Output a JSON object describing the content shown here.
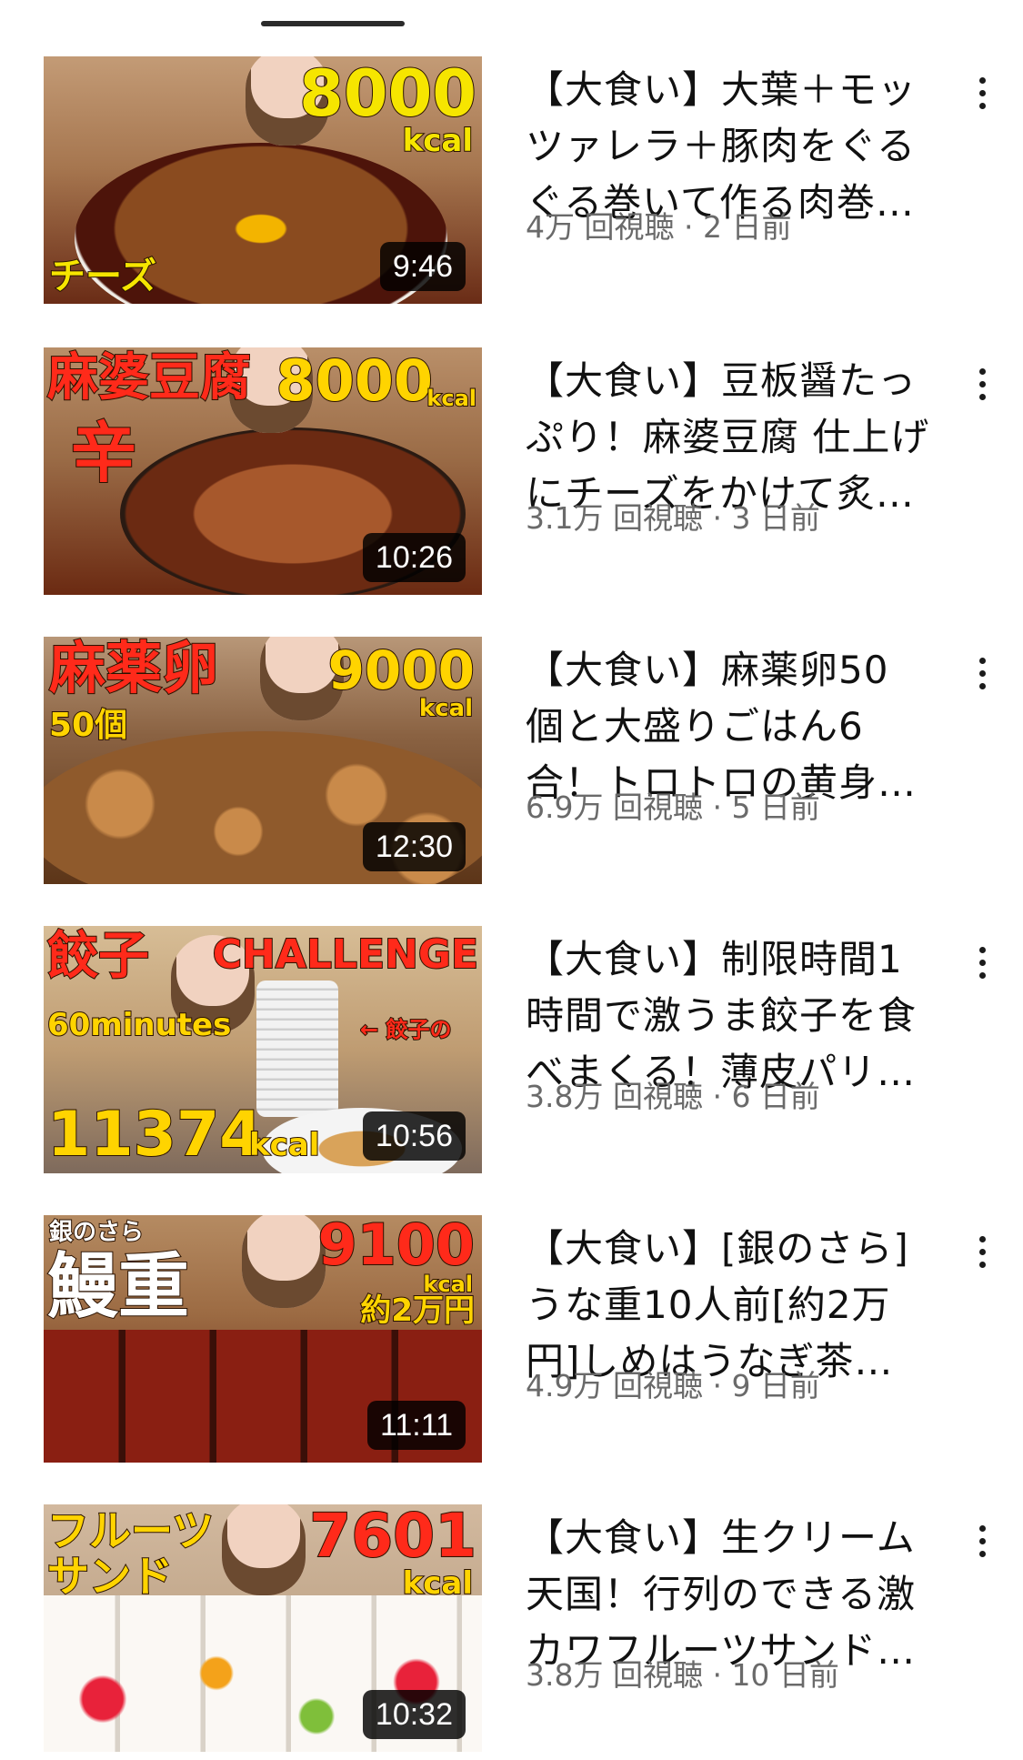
{
  "videos": [
    {
      "title": "【大食い】大葉＋モッ\nツァレラ＋豚肉をぐる\nぐる巻いて作る肉巻…",
      "meta": "4万 回視聴 · 2 日前",
      "duration": "9:46",
      "thumbnail_text": [
        "8000",
        "kcal",
        "チーズ"
      ],
      "thumbnail_colors": {
        "bg": "#b88a62",
        "dish": "#5a1d0f",
        "accent": "#f6e500"
      }
    },
    {
      "title": "【大食い】豆板醤たっ\nぷり！麻婆豆腐 仕上げ\nにチーズをかけて炙…",
      "meta": "3.1万 回視聴 · 3 日前",
      "duration": "10:26",
      "thumbnail_text": [
        "麻婆豆腐",
        "8000",
        "kcal",
        "辛"
      ],
      "thumbnail_colors": {
        "bg": "#a47a55",
        "dish": "#6b2a12",
        "accent": "#ffd400"
      }
    },
    {
      "title": "【大食い】麻薬卵50\n個と大盛りごはん6\n合！トロトロの黄身…",
      "meta": "6.9万 回視聴 · 5 日前",
      "duration": "12:30",
      "thumbnail_text": [
        "麻薬卵",
        "50個",
        "9000",
        "kcal"
      ],
      "thumbnail_colors": {
        "bg": "#8a6242",
        "dish": "#b7773d",
        "accent": "#ffd400"
      }
    },
    {
      "title": "【大食い】制限時間1\n時間で激うま餃子を食\nべまくる！薄皮パリ…",
      "meta": "3.8万 回視聴 · 6 日前",
      "duration": "10:56",
      "thumbnail_text": [
        "餃子",
        "CHALLENGE",
        "60minutes",
        "11374",
        "kcal",
        "← 餃子の"
      ],
      "thumbnail_colors": {
        "bg": "#c8a77e",
        "dish": "#f3f3f3",
        "accent": "#ff2a1a"
      }
    },
    {
      "title": "【大食い】[銀のさら]\nうな重10人前[約2万\n円]しめはうなぎ茶…",
      "meta": "4.9万 回視聴 · 9 日前",
      "duration": "11:11",
      "thumbnail_text": [
        "銀のさら",
        "鰻重",
        "9100",
        "kcal",
        "約2万円"
      ],
      "thumbnail_colors": {
        "bg": "#a3744c",
        "dish": "#7d1f12",
        "accent": "#ffd400"
      }
    },
    {
      "title": "【大食い】生クリーム\n天国！行列のできる激\nカワフルーツサンド…",
      "meta": "3.8万 回視聴 · 10 日前",
      "duration": "10:32",
      "thumbnail_text": [
        "フルーツ",
        "サンド",
        "7601",
        "kcal"
      ],
      "thumbnail_colors": {
        "bg": "#c9b29a",
        "dish": "#f7f1ea",
        "accent": "#ffd400"
      }
    }
  ]
}
